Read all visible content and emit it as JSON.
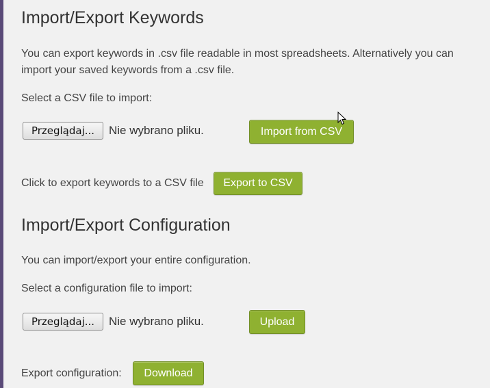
{
  "keywords": {
    "title": "Import/Export Keywords",
    "description": "You can export keywords in .csv file readable in most spreadsheets. Alternatively you can import your saved keywords from a .csv file.",
    "select_label": "Select a CSV file to import:",
    "browse_label": "Przeglądaj...",
    "no_file_text": "Nie wybrano pliku.",
    "import_button": "Import from CSV",
    "export_text": "Click to export keywords to a CSV file",
    "export_button": "Export to CSV"
  },
  "configuration": {
    "title": "Import/Export Configuration",
    "description": "You can import/export your entire configuration.",
    "select_label": "Select a configuration file to import:",
    "browse_label": "Przeglądaj...",
    "no_file_text": "Nie wybrano pliku.",
    "upload_button": "Upload",
    "export_text": "Export configuration:",
    "download_button": "Download"
  },
  "colors": {
    "accent_button": "#8fb131",
    "left_bar": "#5a4a78",
    "background": "#f1f1f1"
  }
}
